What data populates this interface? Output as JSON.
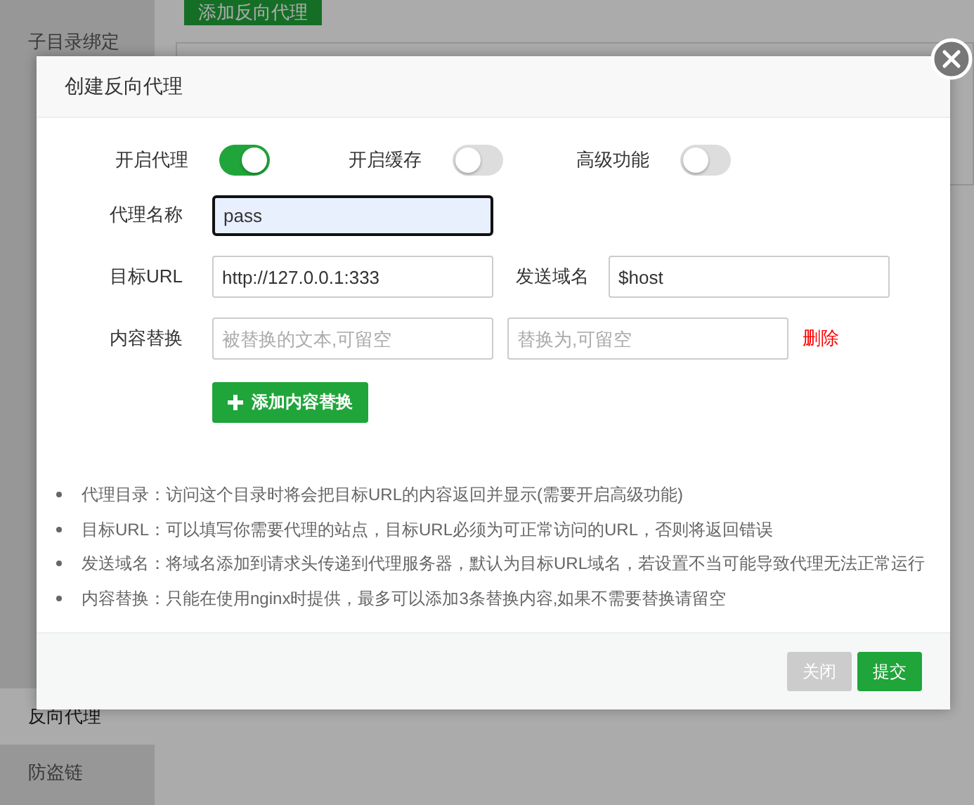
{
  "top_button": "添加反向代理",
  "sidebar": {
    "items": [
      {
        "label": "子目录绑定",
        "selected": false
      },
      {
        "label": "反向代理",
        "selected": true
      },
      {
        "label": "防盗链",
        "selected": false
      }
    ]
  },
  "dialog": {
    "title": "创建反向代理",
    "toggles": [
      {
        "label": "开启代理",
        "on": true
      },
      {
        "label": "开启缓存",
        "on": false
      },
      {
        "label": "高级功能",
        "on": false
      }
    ],
    "rows": [
      {
        "label": "代理名称",
        "fields": [
          {
            "value": "pass",
            "focused": true
          }
        ]
      },
      {
        "label": "目标URL",
        "fields": [
          {
            "value": "http://127.0.0.1:333",
            "focused": false
          }
        ],
        "extra_label": "发送域名",
        "extra_fields": [
          {
            "value": "$host",
            "focused": false
          }
        ]
      },
      {
        "label": "内容替换",
        "fields": [
          {
            "placeholder": "被替换的文本,可留空",
            "focused": false
          },
          {
            "placeholder": "替换为,可留空",
            "focused": false
          }
        ],
        "delete_link": "删除"
      }
    ],
    "add_button": "添加内容替换",
    "notes": [
      "代理目录：访问这个目录时将会把目标URL的内容返回并显示(需要开启高级功能)",
      "目标URL：可以填写你需要代理的站点，目标URL必须为可正常访问的URL，否则将返回错误",
      "发送域名：将域名添加到请求头传递到代理服务器，默认为目标URL域名，若设置不当可能导致代理无法正常运行",
      "内容替换：只能在使用nginx时提供，最多可以添加3条替换内容,如果不需要替换请留空"
    ],
    "buttons": [
      {
        "label": "关闭",
        "kind": "secondary"
      },
      {
        "label": "提交",
        "kind": "primary"
      }
    ]
  }
}
